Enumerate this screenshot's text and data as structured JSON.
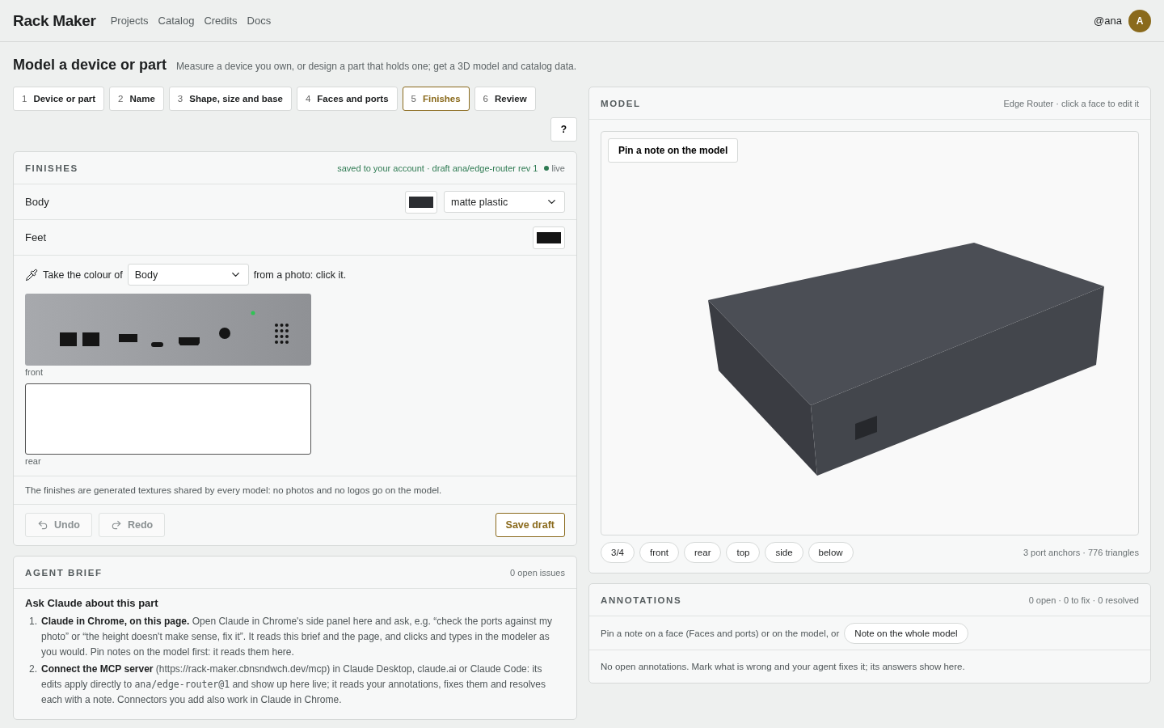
{
  "header": {
    "brand": "Rack Maker",
    "nav": [
      "Projects",
      "Catalog",
      "Credits",
      "Docs"
    ],
    "user": "@ana",
    "avatar": "A"
  },
  "page": {
    "title": "Model a device or part",
    "subtitle": "Measure a device you own, or design a part that holds one; get a 3D model and catalog data."
  },
  "steps": [
    {
      "number": "1",
      "label": "Device or part",
      "selected": false
    },
    {
      "number": "2",
      "label": "Name",
      "selected": false
    },
    {
      "number": "3",
      "label": "Shape, size and base",
      "selected": false
    },
    {
      "number": "4",
      "label": "Faces and ports",
      "selected": false
    },
    {
      "number": "5",
      "label": "Finishes",
      "selected": true
    },
    {
      "number": "6",
      "label": "Review",
      "selected": false
    }
  ],
  "help": "?",
  "finishes": {
    "title": "FINISHES",
    "status": "saved to your account · draft ana/edge-router rev 1",
    "live": "live",
    "rows": [
      {
        "label": "Body",
        "color": "#2b2d31",
        "material": "matte plastic"
      },
      {
        "label": "Feet",
        "color": "#141414"
      }
    ],
    "picker": {
      "before": "Take the colour of",
      "target": "Body",
      "after": "from a photo: click it."
    },
    "photos": [
      {
        "kind": "drawing",
        "caption": "front"
      },
      {
        "kind": "empty",
        "caption": "rear"
      }
    ],
    "note": "The finishes are generated textures shared by every model: no photos and no logos go on the model.",
    "undo": {
      "label": "Undo",
      "disabled": true
    },
    "redo": {
      "label": "Redo",
      "disabled": true
    },
    "save": "Save draft"
  },
  "brief": {
    "title": "AGENT BRIEF",
    "count": "0 open issues",
    "heading": "Ask Claude about this part",
    "items": [
      {
        "marker": "1.",
        "segments": [
          {
            "kind": "rich",
            "text": "**Claude in Chrome, on this page.** Open Claude in Chrome's side panel here and ask, e.g. “check the ports against my photo” or “the height doesn't make sense, fix it”. It reads this brief and the page, and clicks and types in the modeler as you would. Pin notes on the model first: it reads them here."
          }
        ]
      },
      {
        "marker": "2.",
        "segments": [
          {
            "kind": "rich",
            "text": "**Connect the MCP server** (https://rack-maker.cbnsndwch.dev/mcp) in Claude Desktop, claude.ai or Claude Code: its edits apply directly to "
          },
          {
            "kind": "code",
            "text": "ana/edge-router@1"
          },
          {
            "kind": "rich",
            "text": " and show up here live; it reads your annotations, fixes them and resolves each with a note. Connectors you add also work in Claude in Chrome."
          }
        ]
      }
    ]
  },
  "model": {
    "title": "MODEL",
    "info": "Edge Router · click a face to edit it",
    "pin": "Pin a note on the model",
    "views": [
      {
        "label": "3/4",
        "selected": false
      },
      {
        "label": "front",
        "selected": false
      },
      {
        "label": "rear",
        "selected": false
      },
      {
        "label": "top",
        "selected": false
      },
      {
        "label": "side",
        "selected": false
      },
      {
        "label": "below",
        "selected": false
      }
    ],
    "stats": "3 port anchors · 776 triangles"
  },
  "annotations": {
    "title": "ANNOTATIONS",
    "counts": "0 open · 0 to fix · 0 resolved",
    "hint": "Pin a note on a face (Faces and ports) or on the model, or",
    "whole": "Note on the whole model",
    "empty": "No open annotations. Mark what is wrong and your agent fixes it; its answers show here."
  }
}
